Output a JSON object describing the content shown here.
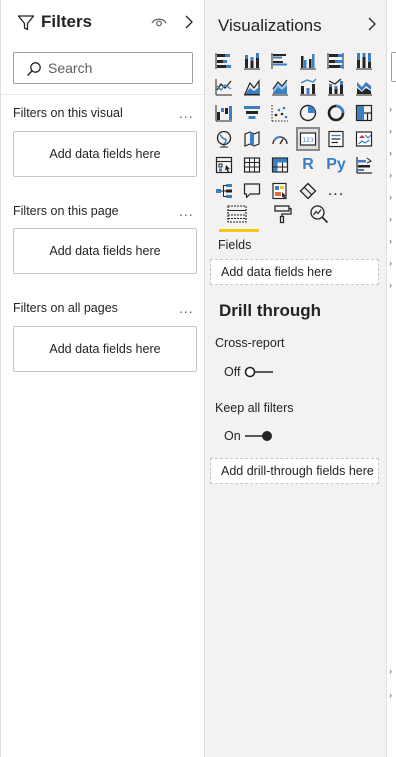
{
  "filters": {
    "title": "Filters",
    "search_placeholder": "Search",
    "sections": [
      {
        "title": "Filters on this visual",
        "more": "...",
        "drop": "Add data fields here"
      },
      {
        "title": "Filters on this page",
        "more": "...",
        "drop": "Add data fields here"
      },
      {
        "title": "Filters on all pages",
        "more": "...",
        "drop": "Add data fields here"
      }
    ],
    "icons": [
      "funnel-icon",
      "eye-icon",
      "chevron-right-icon"
    ]
  },
  "viz": {
    "title": "Visualizations",
    "fields_label": "Fields",
    "fields_drop": "Add data fields here",
    "drill_title": "Drill through",
    "cross_report_label": "Cross-report",
    "cross_report_state": "Off",
    "keep_filters_label": "Keep all filters",
    "keep_filters_state": "On",
    "drill_drop": "Add drill-through fields here",
    "r_label": "R",
    "py_label": "Py",
    "more_visuals": "...",
    "visual_types": [
      "stacked-bar-chart-icon",
      "stacked-column-chart-icon",
      "clustered-bar-chart-icon",
      "clustered-column-chart-icon",
      "100-stacked-bar-chart-icon",
      "100-stacked-column-chart-icon",
      "line-chart-icon",
      "area-chart-icon",
      "stacked-area-chart-icon",
      "line-clustered-column-icon",
      "line-stacked-column-icon",
      "ribbon-chart-icon",
      "waterfall-chart-icon",
      "funnel-chart-icon",
      "scatter-chart-icon",
      "pie-chart-icon",
      "donut-chart-icon",
      "treemap-icon",
      "map-icon",
      "filled-map-icon",
      "gauge-icon",
      "card-icon",
      "multi-row-card-icon",
      "kpi-icon",
      "slicer-icon",
      "table-icon",
      "matrix-icon",
      "r-script-visual-icon",
      "python-visual-icon",
      "key-influencers-icon",
      "decomposition-tree-icon",
      "qa-icon",
      "paginated-report-icon",
      "power-apps-icon",
      "more-visuals-icon"
    ],
    "colors": {
      "accent_yellow": "#f2c811",
      "blue": "#3a7fc4",
      "pane_bg": "#f3f2f1"
    }
  }
}
